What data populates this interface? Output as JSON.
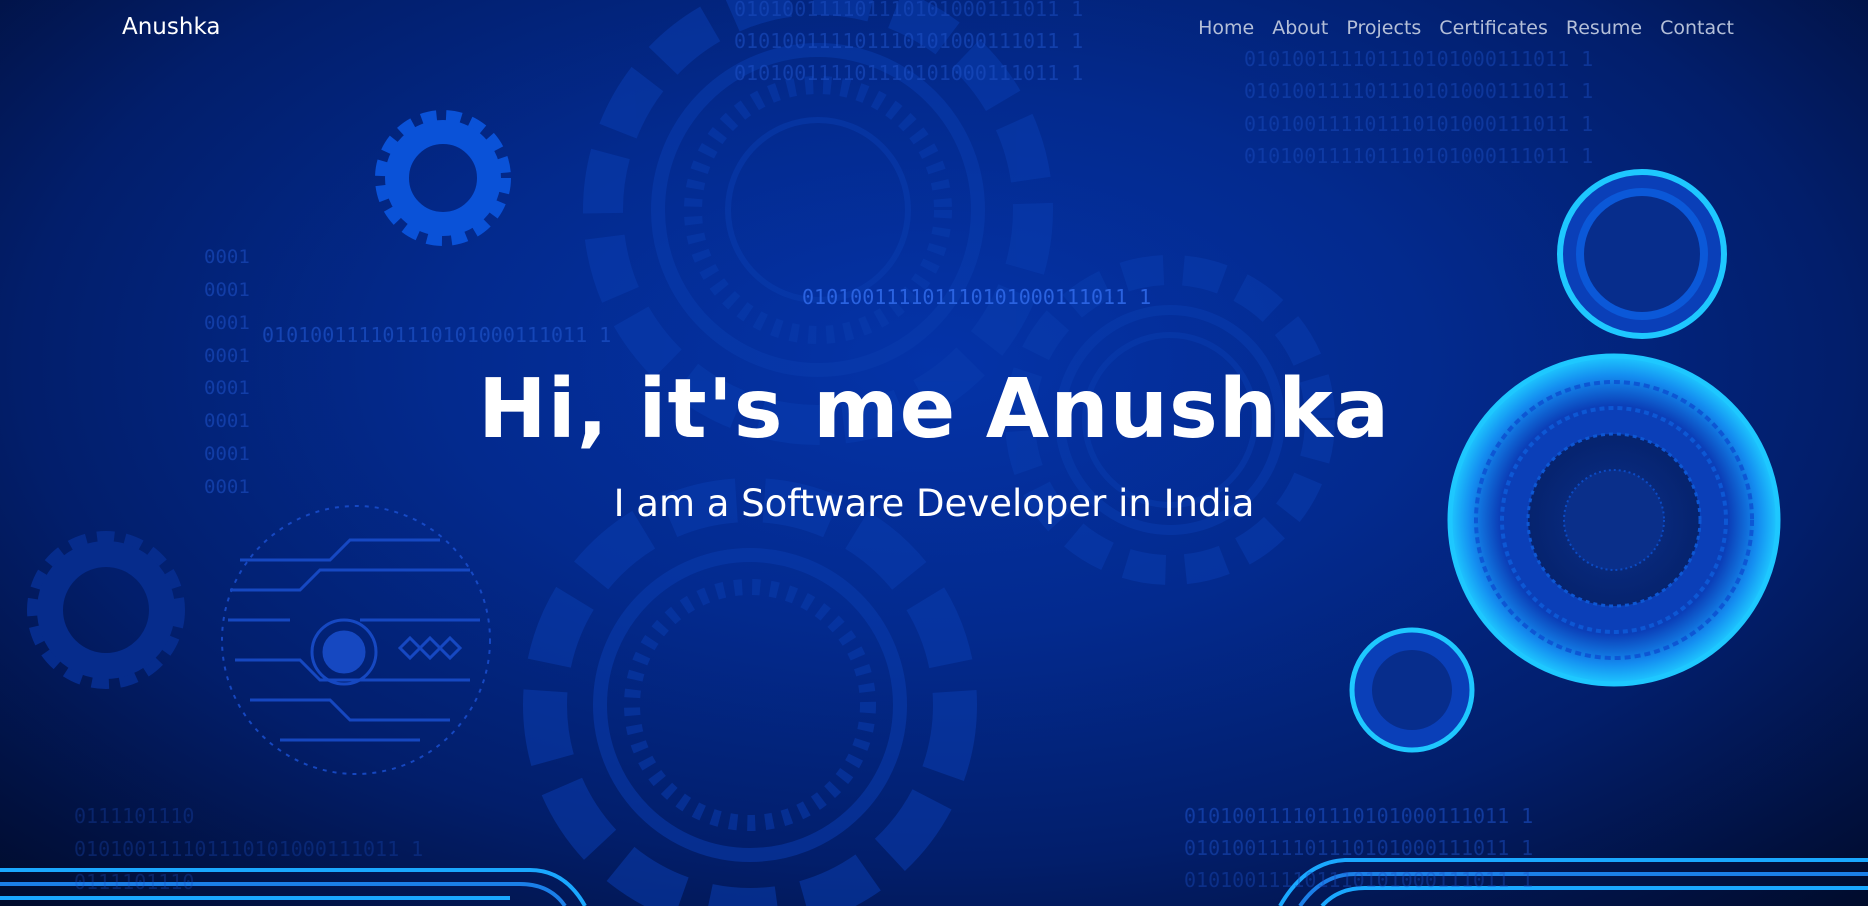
{
  "nav": {
    "brand": "Anushka",
    "links": [
      "Home",
      "About",
      "Projects",
      "Certificates",
      "Resume",
      "Contact"
    ]
  },
  "hero": {
    "title": "Hi, it's me Anushka",
    "subtitle": "I am a Software Developer in India"
  },
  "background": {
    "binary_string": "010100111101110101000111011 1",
    "short_binary": "0001",
    "colors": {
      "base": "#032a8e",
      "dark_edge": "#000a26",
      "gear_bright": "#0a52d8",
      "glow": "#19b4ff",
      "binary_text": "#1c4fc4"
    }
  }
}
